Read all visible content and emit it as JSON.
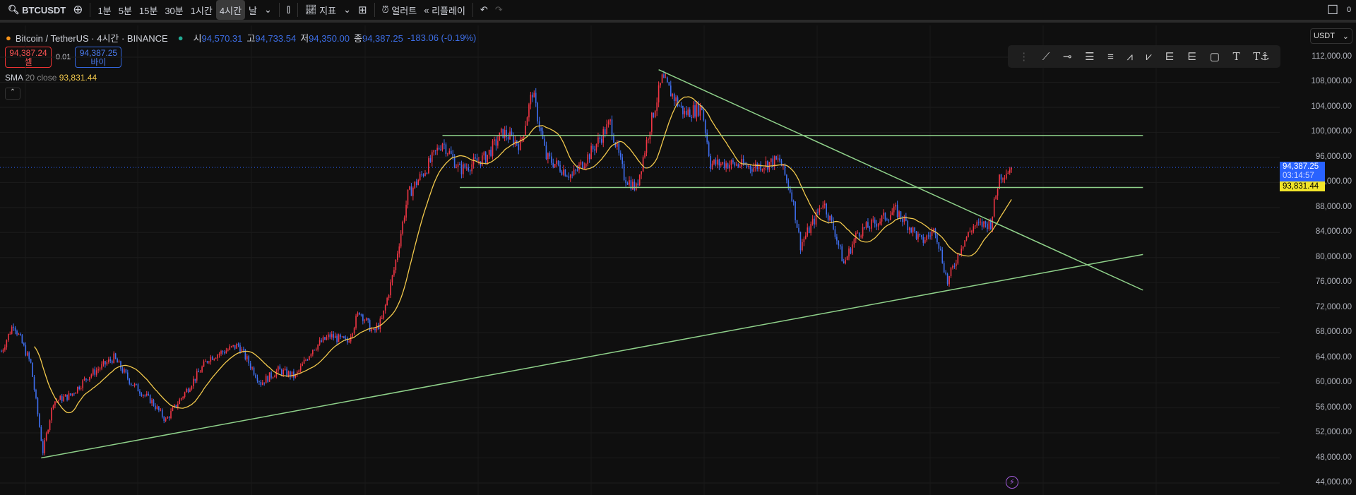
{
  "toolbar": {
    "symbol": "BTCUSDT",
    "intervals": [
      "1분",
      "5분",
      "15분",
      "30분",
      "1시간",
      "4시간",
      "날"
    ],
    "active_interval": "4시간",
    "indicators": "지표",
    "alert": "얼러트",
    "replay": "리플레이",
    "corner": "0"
  },
  "legend": {
    "title": "Bitcoin / TetherUS · 4시간 · BINANCE",
    "o_label": "시",
    "o": "94,570.31",
    "h_label": "고",
    "h": "94,733.54",
    "l_label": "저",
    "l": "94,350.00",
    "c_label": "종",
    "c": "94,387.25",
    "change": "-183.06 (-0.19%)"
  },
  "trade": {
    "sell_price": "94,387.24",
    "sell_label": "셀",
    "spread": "0.01",
    "buy_price": "94,387.25",
    "buy_label": "바이"
  },
  "sma": {
    "name": "SMA",
    "params": "20 close",
    "value": "93,831.44"
  },
  "currency": "USDT",
  "price_tag": {
    "price": "94,387.25",
    "countdown": "03:14:57",
    "sma": "93,831.44"
  },
  "colors": {
    "up": "#f23645",
    "down": "#3f6ff0",
    "sma": "#f2c94c",
    "lines": "#8fd18a",
    "accent": "#2962ff"
  },
  "chart_data": {
    "type": "candlestick",
    "yticks": [
      "112,000.00",
      "108,000.00",
      "104,000.00",
      "100,000.00",
      "96,000.00",
      "92,000.00",
      "88,000.00",
      "84,000.00",
      "80,000.00",
      "76,000.00",
      "72,000.00",
      "68,000.00",
      "64,000.00",
      "60,000.00",
      "56,000.00",
      "52,000.00",
      "48,000.00",
      "44,000.00"
    ],
    "ylim": [
      44000,
      112000
    ],
    "last_price": 94387.25,
    "waypoints": [
      [
        0,
        65000
      ],
      [
        7,
        69500
      ],
      [
        17,
        63000
      ],
      [
        24,
        49000
      ],
      [
        30,
        57000
      ],
      [
        40,
        58000
      ],
      [
        50,
        61000
      ],
      [
        65,
        64000
      ],
      [
        75,
        60000
      ],
      [
        87,
        57000
      ],
      [
        95,
        54000
      ],
      [
        110,
        60000
      ],
      [
        120,
        64000
      ],
      [
        137,
        66000
      ],
      [
        150,
        60000
      ],
      [
        160,
        62000
      ],
      [
        170,
        61000
      ],
      [
        180,
        65500
      ],
      [
        190,
        67500
      ],
      [
        200,
        66500
      ],
      [
        207,
        71500
      ],
      [
        215,
        68000
      ],
      [
        220,
        70000
      ],
      [
        227,
        78000
      ],
      [
        235,
        90000
      ],
      [
        245,
        94000
      ],
      [
        255,
        98500
      ],
      [
        265,
        94000
      ],
      [
        280,
        96000
      ],
      [
        290,
        100000
      ],
      [
        300,
        98000
      ],
      [
        307,
        106500
      ],
      [
        315,
        96000
      ],
      [
        330,
        93000
      ],
      [
        340,
        96500
      ],
      [
        352,
        101500
      ],
      [
        360,
        93000
      ],
      [
        367,
        91000
      ],
      [
        375,
        101000
      ],
      [
        382,
        108500
      ],
      [
        395,
        103000
      ],
      [
        405,
        104000
      ],
      [
        410,
        95000
      ],
      [
        420,
        95000
      ],
      [
        435,
        94500
      ],
      [
        450,
        95500
      ],
      [
        457,
        90000
      ],
      [
        462,
        82000
      ],
      [
        470,
        86000
      ],
      [
        475,
        89000
      ],
      [
        482,
        84000
      ],
      [
        487,
        79000
      ],
      [
        495,
        84000
      ],
      [
        505,
        85500
      ],
      [
        517,
        87500
      ],
      [
        525,
        85000
      ],
      [
        532,
        82500
      ],
      [
        540,
        84500
      ],
      [
        547,
        76000
      ],
      [
        555,
        82000
      ],
      [
        562,
        85000
      ],
      [
        572,
        85500
      ],
      [
        577,
        93000
      ],
      [
        584,
        94400
      ]
    ],
    "drawings": [
      {
        "type": "hline",
        "from": [
          255,
          99500
        ],
        "to": [
          660,
          99500
        ]
      },
      {
        "type": "hline",
        "from": [
          265,
          91200
        ],
        "to": [
          660,
          91200
        ]
      },
      {
        "type": "trend",
        "from": [
          23,
          48000
        ],
        "to": [
          660,
          80500
        ]
      },
      {
        "type": "trend",
        "from": [
          380,
          110000
        ],
        "to": [
          660,
          74800
        ]
      }
    ]
  }
}
